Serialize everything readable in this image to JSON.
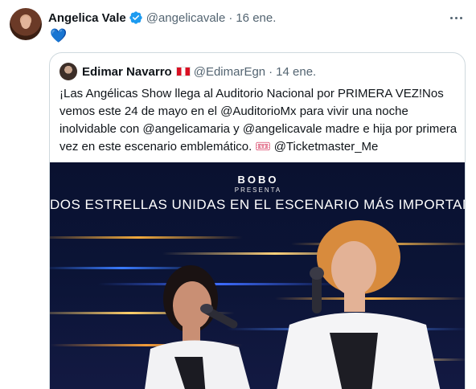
{
  "author": {
    "name": "Angelica Vale",
    "handle": "@angelicavale",
    "separator": "·",
    "date": "16 ene.",
    "verified": true,
    "body_emoji": "💙"
  },
  "quoted": {
    "name": "Edimar Navarro",
    "flag": "Peru flag",
    "handle": "@EdimarEgn",
    "separator": "·",
    "date": "14 ene.",
    "text_main": "¡Las Angélicas Show llega al Auditorio Nacional por PRIMERA VEZ!Nos vemos este 24 de mayo en el @AuditorioMx para vivir una noche inolvidable con @angelicamaria y @angelicavale madre e hija por primera vez en este escenario emblemático.",
    "ticket_emoji": "🎟",
    "text_tail": "@Ticketmaster_Me",
    "media": {
      "brand": "BOBO",
      "brand_sub": "PRESENTA",
      "headline": "DOS ESTRELLAS UNIDAS EN EL ESCENARIO MÁS IMPORTANTE"
    }
  },
  "colors": {
    "verified": "#1d9bf0",
    "muted_text": "#536471",
    "heart": "#5cadeb",
    "poster_bg": "#0b1436"
  },
  "icons": [
    "verified-badge-icon",
    "more-options-icon",
    "blue-heart-icon",
    "peru-flag-icon",
    "ticket-icon"
  ]
}
